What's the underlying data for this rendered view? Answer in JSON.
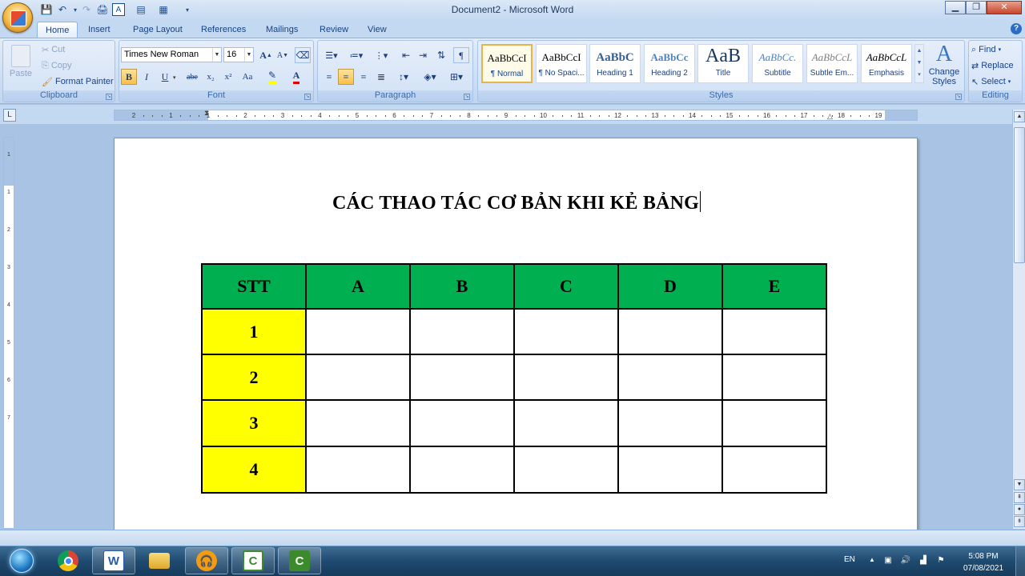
{
  "window": {
    "title": "Document2 - Microsoft Word",
    "minimize": "▁",
    "restore": "❐",
    "close": "✕"
  },
  "tabs": [
    "Home",
    "Insert",
    "Page Layout",
    "References",
    "Mailings",
    "Review",
    "View"
  ],
  "clipboard": {
    "paste": "Paste",
    "cut": "Cut",
    "copy": "Copy",
    "format_painter": "Format Painter",
    "label": "Clipboard"
  },
  "font": {
    "name": "Times New Roman",
    "size": "16",
    "label": "Font",
    "bold": "B",
    "italic": "I",
    "underline": "U",
    "strike": "abe",
    "sub": "x₂",
    "sup": "x²",
    "case": "Aa",
    "grow": "A",
    "shrink": "A"
  },
  "paragraph": {
    "label": "Paragraph",
    "pilcrow": "¶"
  },
  "styles": {
    "label": "Styles",
    "items": [
      {
        "preview": "AaBbCcI",
        "name": "¶ Normal"
      },
      {
        "preview": "AaBbCcI",
        "name": "¶ No Spaci..."
      },
      {
        "preview": "AaBbC",
        "name": "Heading 1"
      },
      {
        "preview": "AaBbCc",
        "name": "Heading 2"
      },
      {
        "preview": "AaB",
        "name": "Title"
      },
      {
        "preview": "AaBbCc.",
        "name": "Subtitle"
      },
      {
        "preview": "AaBbCcL",
        "name": "Subtle Em..."
      },
      {
        "preview": "AaBbCcL",
        "name": "Emphasis"
      }
    ],
    "change": "Change Styles"
  },
  "editing": {
    "label": "Editing",
    "find": "Find",
    "replace": "Replace",
    "select": "Select"
  },
  "ruler": {
    "corner": "L",
    "numbers": [
      "2",
      "1",
      "1",
      "2",
      "3",
      "4",
      "5",
      "6",
      "7",
      "8",
      "9",
      "10",
      "11",
      "12",
      "13",
      "14",
      "15",
      "16",
      "17",
      "18",
      "19"
    ]
  },
  "vruler": {
    "numbers": [
      "1",
      "1",
      "2",
      "3",
      "4",
      "5",
      "6",
      "7"
    ]
  },
  "document": {
    "title": "CÁC THAO TÁC CƠ BẢN KHI KẺ BẢNG",
    "table": {
      "headers": [
        "STT",
        "A",
        "B",
        "C",
        "D",
        "E"
      ],
      "rows": [
        [
          "1",
          "",
          "",
          "",
          "",
          ""
        ],
        [
          "2",
          "",
          "",
          "",
          "",
          ""
        ],
        [
          "3",
          "",
          "",
          "",
          "",
          ""
        ],
        [
          "4",
          "",
          "",
          "",
          "",
          ""
        ]
      ]
    }
  },
  "colors": {
    "header_green": "#00b050",
    "stt_yellow": "#ffff00"
  },
  "taskbar": {
    "items": [
      "chrome-icon",
      "word-icon",
      "explorer-icon",
      "audio-app-icon",
      "camtasia-icon",
      "camtasia-recorder-icon"
    ],
    "lang": "EN",
    "time": "5:08 PM",
    "date": "07/08/2021"
  }
}
